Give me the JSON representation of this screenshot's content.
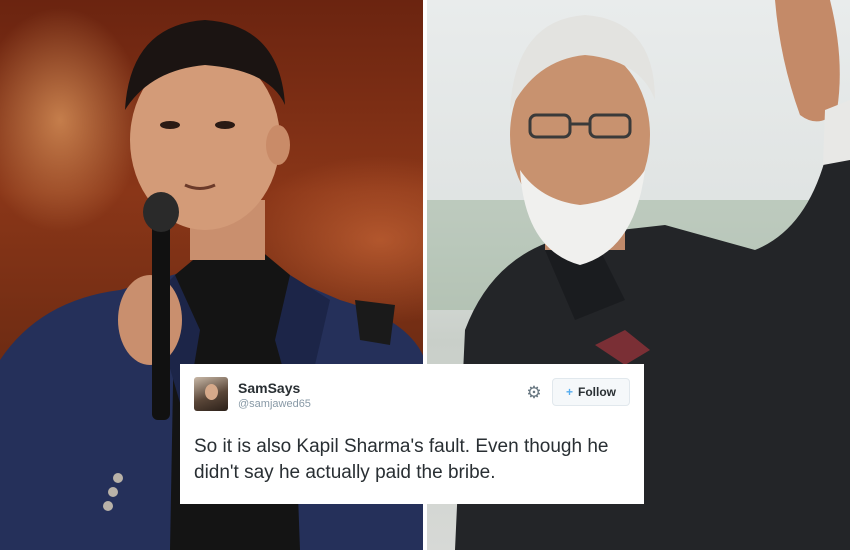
{
  "tweet": {
    "display_name": "SamSays",
    "handle": "@samjawed65",
    "follow_label": "Follow",
    "text": "So it is also Kapil Sharma's fault. Even though he didn't say he actually paid the bribe.",
    "icons": {
      "settings": "gear-icon",
      "follow": "add-user-icon"
    }
  },
  "photos": {
    "left": "photo of comedian speaking into a microphone",
    "right": "photo of man in dark jacket waving"
  },
  "colors": {
    "text": "#292f33",
    "muted": "#8899a6",
    "accent": "#55acee"
  }
}
